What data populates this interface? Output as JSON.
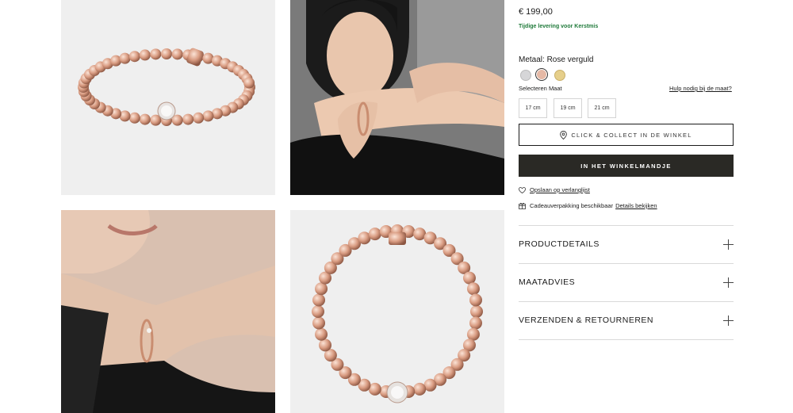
{
  "gallery": {
    "tiles": [
      {
        "kind": "product-photo",
        "icon": "beaded-bracelet-top-view"
      },
      {
        "kind": "model-photo",
        "icon": "model-wearing-bracelet"
      },
      {
        "kind": "model-photo",
        "icon": "model-wrist-closeup"
      },
      {
        "kind": "product-photo",
        "icon": "beaded-bracelet-front-view"
      }
    ]
  },
  "product": {
    "price": "€ 199,00",
    "delivery_note": "Tijdige levering voor Kerstmis",
    "metal_label": "Metaal: Rose verguld",
    "metal_swatches": [
      {
        "name": "silver",
        "color": "#d6d6d8",
        "selected": false
      },
      {
        "name": "rose",
        "color": "#e5b9a6",
        "selected": true
      },
      {
        "name": "gold",
        "color": "#e6cf8b",
        "selected": false
      }
    ],
    "size_label": "Selecteren Maat",
    "size_help": "Hulp nodig bij de maat?",
    "sizes": [
      "17 cm",
      "19 cm",
      "21 cm"
    ]
  },
  "actions": {
    "click_collect": "CLICK & COLLECT IN DE WINKEL",
    "add_to_cart": "IN HET WINKELMANDJE",
    "wishlist": "Opslaan op verlanglijst",
    "gift_text": "Cadeauverpakking beschikbaar",
    "gift_link": "Details bekijken"
  },
  "accordion": [
    {
      "label": "PRODUCTDETAILS"
    },
    {
      "label": "MAATADVIES"
    },
    {
      "label": "VERZENDEN & RETOURNEREN"
    }
  ],
  "colors": {
    "accent_dark": "#2a2925",
    "delivery_green": "#1f7a3a",
    "divider": "#d9d9d9"
  }
}
